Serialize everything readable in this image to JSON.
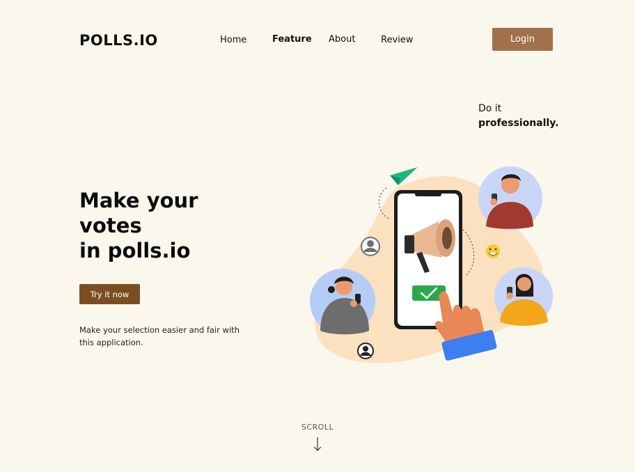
{
  "brand": {
    "logo_text": "POLLS.IO"
  },
  "nav": {
    "home": "Home",
    "feature": "Feature",
    "about": "About",
    "review": "Review",
    "login": "Login"
  },
  "tagline": {
    "line1": "Do it",
    "line2": "professionally."
  },
  "hero": {
    "headline_line1": "Make your",
    "headline_line2": "votes",
    "headline_line3": "in polls.io",
    "cta_label": "Try it now",
    "description": "Make your selection easier and fair with this application."
  },
  "scroll": {
    "label": "SCROLL"
  },
  "colors": {
    "background": "#faf7ed",
    "login_button": "#a0714a",
    "cta_button": "#7b4e22",
    "blob": "#fbe1c0",
    "accent_green": "#2aa84a"
  },
  "icons": [
    "paper-plane-icon",
    "user-icon",
    "smiley-icon",
    "megaphone-icon",
    "checkmark-icon",
    "arrow-down-icon"
  ]
}
